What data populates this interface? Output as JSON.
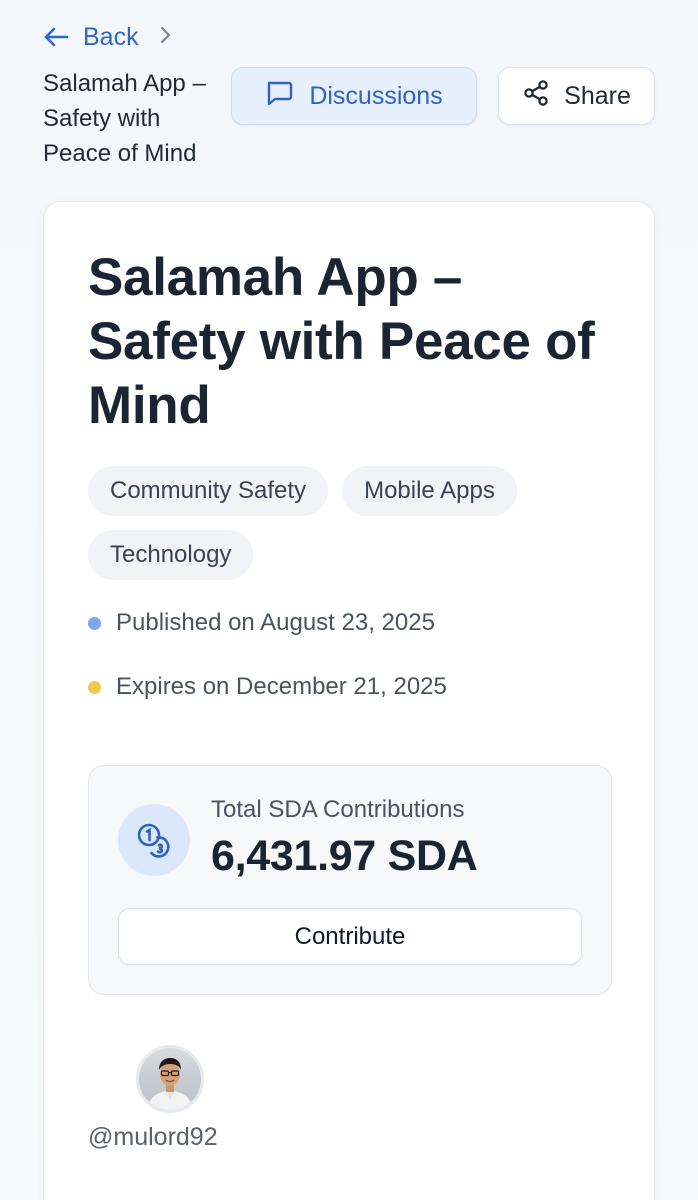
{
  "nav": {
    "back_label": "Back",
    "breadcrumb_title": "Salamah App – Safety with Peace of Mind"
  },
  "actions": {
    "discussions_label": "Discussions",
    "share_label": "Share"
  },
  "project": {
    "title": "Salamah App – Safety with Peace of Mind",
    "tags": [
      "Community Safety",
      "Mobile Apps",
      "Technology"
    ],
    "published": "Published on August 23, 2025",
    "expires": "Expires on December 21, 2025"
  },
  "contributions": {
    "label": "Total SDA Contributions",
    "amount": "6,431.97 SDA",
    "button_label": "Contribute"
  },
  "author": {
    "username": "@mulord92"
  },
  "colors": {
    "accent": "#2f66c9",
    "published_dot": "#7aa7f0",
    "expires_dot": "#f2c94c"
  },
  "icons": {
    "back": "arrow-left-icon",
    "breadcrumb_sep": "chevron-right-icon",
    "discussions": "chat-bubble-icon",
    "share": "share-icon",
    "coins": "coins-icon"
  }
}
